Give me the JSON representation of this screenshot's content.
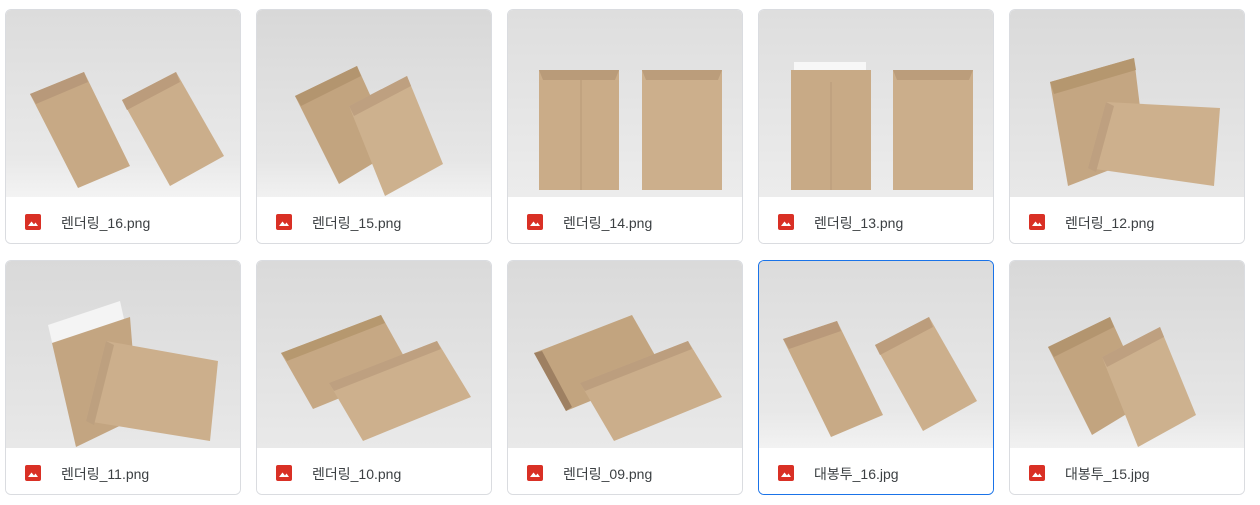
{
  "files": [
    {
      "name": "렌더링_16.png",
      "type_icon": "image-icon",
      "selected": false
    },
    {
      "name": "렌더링_15.png",
      "type_icon": "image-icon",
      "selected": false
    },
    {
      "name": "렌더링_14.png",
      "type_icon": "image-icon",
      "selected": false
    },
    {
      "name": "렌더링_13.png",
      "type_icon": "image-icon",
      "selected": false
    },
    {
      "name": "렌더링_12.png",
      "type_icon": "image-icon",
      "selected": false
    },
    {
      "name": "렌더링_11.png",
      "type_icon": "image-icon",
      "selected": false
    },
    {
      "name": "렌더링_10.png",
      "type_icon": "image-icon",
      "selected": false
    },
    {
      "name": "렌더링_09.png",
      "type_icon": "image-icon",
      "selected": false
    },
    {
      "name": "대봉투_16.jpg",
      "type_icon": "image-icon",
      "selected": true
    },
    {
      "name": "대봉투_15.jpg",
      "type_icon": "image-icon",
      "selected": false
    }
  ],
  "colors": {
    "accent": "#1a73e8",
    "image_icon": "#d93025",
    "kraft": "#c9ab88",
    "kraft_dark": "#b59573",
    "backdrop": "#e4e4e4"
  }
}
